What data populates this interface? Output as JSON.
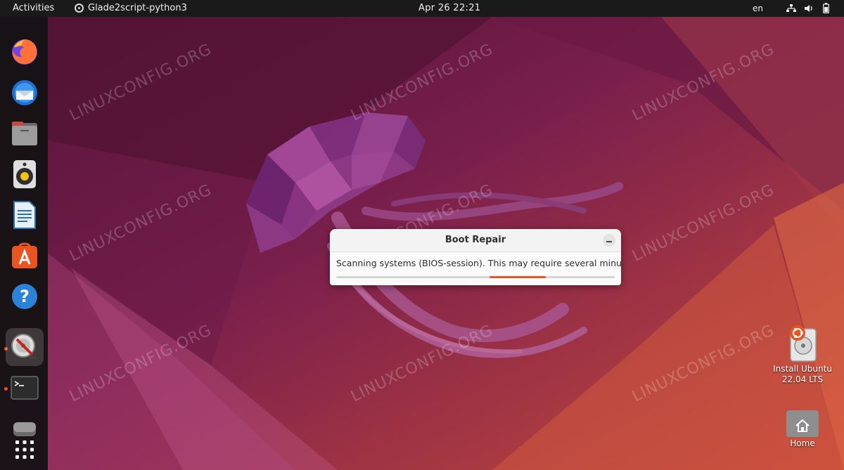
{
  "topbar": {
    "activities_label": "Activities",
    "app_name": "Glade2script-python3",
    "clock": "Apr 26  22:21",
    "keyboard_layout": "en",
    "icons": [
      "network-icon",
      "volume-icon",
      "battery-icon"
    ]
  },
  "dock": {
    "items": [
      {
        "name": "firefox",
        "icon": "firefox-icon"
      },
      {
        "name": "thunderbird",
        "icon": "thunderbird-icon"
      },
      {
        "name": "files",
        "icon": "files-icon"
      },
      {
        "name": "rhythmbox",
        "icon": "rhythmbox-icon"
      },
      {
        "name": "libreoffice-writer",
        "icon": "writer-icon"
      },
      {
        "name": "software",
        "icon": "app-center-icon"
      },
      {
        "name": "help",
        "icon": "help-icon"
      },
      {
        "name": "boot-repair",
        "icon": "boot-repair-icon",
        "active": true
      },
      {
        "name": "terminal",
        "icon": "terminal-icon",
        "running": true
      },
      {
        "name": "disk",
        "icon": "disk-icon"
      },
      {
        "name": "show-apps",
        "icon": "grid-icon"
      }
    ]
  },
  "watermark": "LINUXCONFIG.ORG",
  "dialog": {
    "title": "Boot Repair",
    "message": "Scanning systems (BIOS-session). This may require several minutes...",
    "progress_indeterminate": true
  },
  "desktop": {
    "install_label_line1": "Install Ubuntu",
    "install_label_line2": "22.04 LTS",
    "home_label": "Home"
  },
  "colors": {
    "accent": "#e95420",
    "topbar": "#1a1a1a",
    "dock": "#121212"
  }
}
